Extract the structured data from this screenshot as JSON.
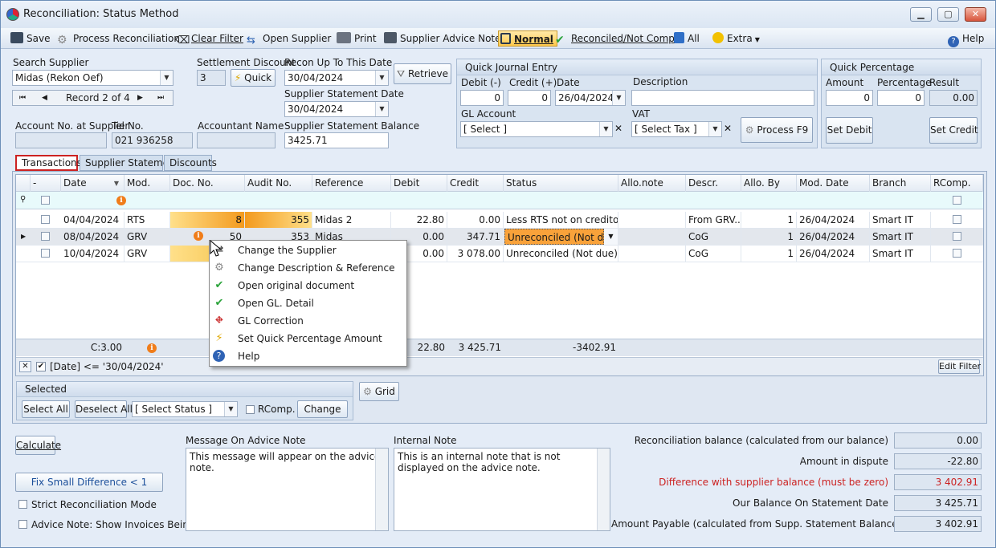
{
  "window": {
    "title": "Reconciliation: Status Method"
  },
  "toolbar": {
    "save": "Save",
    "process": "Process Reconciliation",
    "clear_filter": "Clear Filter",
    "open_supplier": "Open Supplier",
    "print": "Print",
    "advice_note": "Supplier Advice Note",
    "normal": "Normal",
    "reconciled": "Reconciled/Not Comp",
    "all": "All",
    "extra": "Extra",
    "help": "Help"
  },
  "search": {
    "label": "Search Supplier",
    "value": "Midas (Rekon Oef)",
    "record": "Record 2 of 4"
  },
  "settlement": {
    "label": "Settlement Discount",
    "value": "3",
    "quick": "Quick"
  },
  "recon_date": {
    "label": "Recon Up To This Date",
    "value": "30/04/2024"
  },
  "retrieve": "Retrieve",
  "stmt_date": {
    "label": "Supplier Statement Date",
    "value": "30/04/2024"
  },
  "account": {
    "label": "Account No. at Supplier",
    "value": ""
  },
  "tel": {
    "label": "Tel No.",
    "value": "021 936258"
  },
  "accountant": {
    "label": "Accountant Name",
    "value": ""
  },
  "stmt_balance": {
    "label": "Supplier Statement Balance",
    "value": "3425.71"
  },
  "journal": {
    "title": "Quick Journal Entry",
    "debit_label": "Debit (-)",
    "debit": "0",
    "credit_label": "Credit (+)",
    "credit": "0",
    "date_label": "Date",
    "date": "26/04/2024",
    "desc_label": "Description",
    "desc": "",
    "gl_label": "GL Account",
    "gl": "[ Select ]",
    "vat_label": "VAT",
    "vat": "[ Select Tax ]",
    "process": "Process F9"
  },
  "quickpct": {
    "title": "Quick Percentage",
    "amount_label": "Amount",
    "amount": "0",
    "pct_label": "Percentage",
    "pct": "0",
    "result_label": "Result",
    "result": "0.00",
    "set_debit": "Set Debit",
    "set_credit": "Set Credit"
  },
  "tabs": [
    "Transactions",
    "Supplier Statement",
    "Discounts"
  ],
  "grid": {
    "headers": [
      "-",
      "Date",
      "Mod.",
      "Doc. No.",
      "Audit No.",
      "Reference",
      "Debit",
      "Credit",
      "Status",
      "Allo.note",
      "Descr.",
      "Allo. By",
      "Mod. Date",
      "Branch",
      "RComp."
    ],
    "rows": [
      {
        "date": "04/04/2024",
        "mod": "RTS",
        "doc": "8",
        "audit": "355",
        "ref": "Midas 2",
        "debit": "22.80",
        "credit": "0.00",
        "status": "Less RTS not on creditor s...",
        "allo": "",
        "descr": "From GRV...",
        "alloby": "1",
        "moddate": "26/04/2024",
        "branch": "Smart IT"
      },
      {
        "date": "08/04/2024",
        "mod": "GRV",
        "doc": "50",
        "audit": "353",
        "ref": "Midas",
        "debit": "0.00",
        "credit": "347.71",
        "status": "Unreconciled (Not due)",
        "allo": "",
        "descr": "CoG",
        "alloby": "1",
        "moddate": "26/04/2024",
        "branch": "Smart IT"
      },
      {
        "date": "10/04/2024",
        "mod": "GRV",
        "doc": "",
        "audit": "",
        "ref": "",
        "debit": "0.00",
        "credit": "3 078.00",
        "status": "Unreconciled (Not due)",
        "allo": "",
        "descr": "CoG",
        "alloby": "1",
        "moddate": "26/04/2024",
        "branch": "Smart IT"
      }
    ],
    "summary": {
      "count": "C:3.00",
      "debit": "22.80",
      "credit": "3 425.71",
      "status": "-3402.91"
    },
    "filter_text": "[Date] <= '30/04/2024'",
    "edit_filter": "Edit Filter"
  },
  "context_menu": [
    "Change the Supplier",
    "Change Description & Reference",
    "Open original document",
    "Open GL. Detail",
    "GL Correction",
    "Set Quick Percentage Amount",
    "Help"
  ],
  "selected": {
    "title": "Selected",
    "select_all": "Select All",
    "deselect_all": "Deselect All",
    "status": "[ Select Status ]",
    "rcomp": "RComp.",
    "change": "Change",
    "grid": "Grid"
  },
  "bottom": {
    "calculate": "Calculate",
    "fix": "Fix Small Difference < 1",
    "strict": "Strict Reconciliation Mode",
    "advice_show": "Advice Note: Show Invoices Being Paid",
    "msg_label": "Message On Advice Note",
    "msg": "This message will appear on the advice note.",
    "internal_label": "Internal Note",
    "internal": "This is an internal note that is not displayed on the advice note.",
    "recon_bal_label": "Reconciliation balance (calculated from our balance)",
    "recon_bal": "0.00",
    "dispute_label": "Amount in dispute",
    "dispute": "-22.80",
    "diff_label": "Difference with supplier balance (must be zero)",
    "diff": "3 402.91",
    "our_bal_label": "Our Balance On Statement Date",
    "our_bal": "3 425.71",
    "payable_label": "Amount Payable (calculated from Supp. Statement Balance)",
    "payable": "3 402.91"
  },
  "colors": {
    "accent_red": "#c22",
    "highlight_orange": "#f7a21b",
    "active_tool": "#ffc94d"
  }
}
